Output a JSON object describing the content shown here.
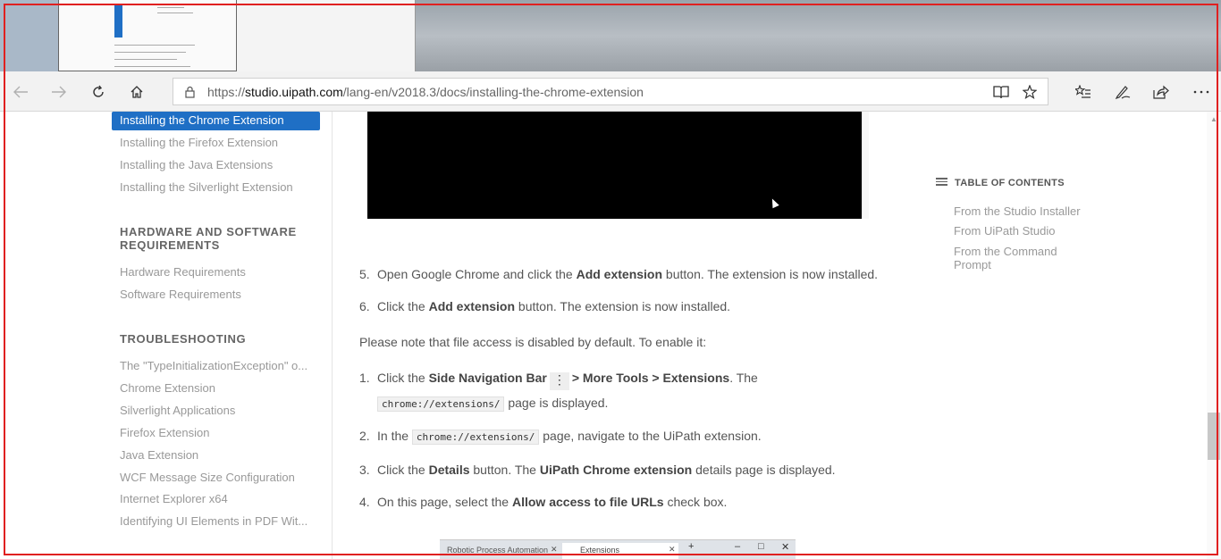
{
  "browser": {
    "address_url_prefix": "https://",
    "address_url_domain": "studio.uipath.com",
    "address_url_path": "/lang-en/v2018.3/docs/installing-the-chrome-extension",
    "icons": {
      "back": "back-arrow-icon",
      "forward": "forward-arrow-icon",
      "refresh": "refresh-icon",
      "home": "home-icon",
      "lock": "lock-icon",
      "reading_view": "reading-view-icon",
      "favorite": "star-icon",
      "favorites_hub": "favorites-list-icon",
      "pen": "pen-icon",
      "share": "share-icon",
      "more": "more-icon"
    }
  },
  "sidebar": {
    "active_item": "Installing the Chrome Extension",
    "extension_items": [
      "Installing the Firefox Extension",
      "Installing the Java Extensions",
      "Installing the Silverlight Extension"
    ],
    "hardware_heading_line1": "HARDWARE AND SOFTWARE",
    "hardware_heading_line2": "REQUIREMENTS",
    "hardware_items": [
      "Hardware Requirements",
      "Software Requirements"
    ],
    "troubleshooting_heading": "TROUBLESHOOTING",
    "troubleshooting_items": [
      "The \"TypeInitializationException\" o...",
      "Chrome Extension",
      "Silverlight Applications",
      "Firefox Extension",
      "Java Extension",
      "WCF Message Size Configuration",
      "Internet Explorer x64",
      "Identifying UI Elements in PDF Wit..."
    ]
  },
  "content": {
    "step5": {
      "num": "5.",
      "pre": "Open Google Chrome and click the ",
      "bold": "Add extension",
      "post": " button. The extension is now installed."
    },
    "step6": {
      "num": "6.",
      "pre": "Click the ",
      "bold": "Add extension",
      "post": " button. The extension is now installed."
    },
    "note": "Please note that file access is disabled by default. To enable it:",
    "f1": {
      "num": "1.",
      "pre": "Click the ",
      "bold1": "Side Navigation Bar",
      "kebab": "⋮",
      "bold2": "> More Tools > Extensions",
      "post": ". The",
      "code": "chrome://extensions/",
      "line2": " page is displayed."
    },
    "f2": {
      "num": "2.",
      "pre": "In the ",
      "code": "chrome://extensions/",
      "post": " page, navigate to the UiPath extension."
    },
    "f3": {
      "num": "3.",
      "pre": "Click the ",
      "bold1": "Details",
      "mid": " button. The ",
      "bold2": "UiPath Chrome extension",
      "post": " details page is displayed."
    },
    "f4": {
      "num": "4.",
      "pre": "On this page, select the ",
      "bold": "Allow access to file URLs",
      "post": " check box."
    }
  },
  "toc": {
    "heading": "TABLE OF CONTENTS",
    "items": [
      "From the Studio Installer",
      "From UiPath Studio",
      "From the Command",
      "Prompt"
    ]
  },
  "embedded": {
    "tab1": "Robotic Process Automation",
    "tab2": "Extensions",
    "new_tab": "+",
    "minimize": "–",
    "maximize": "□",
    "close": "✕"
  }
}
